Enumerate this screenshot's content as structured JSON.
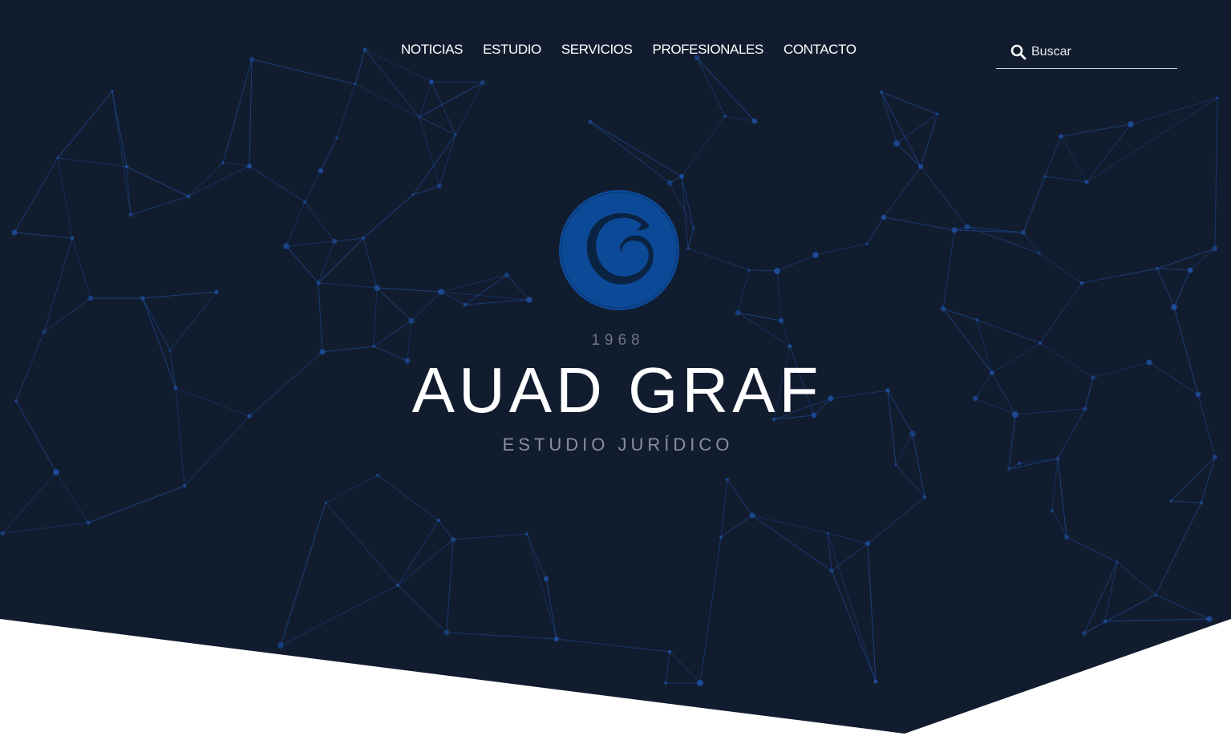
{
  "nav": {
    "items": [
      {
        "label": "NOTICIAS"
      },
      {
        "label": "ESTUDIO"
      },
      {
        "label": "SERVICIOS"
      },
      {
        "label": "PROFESIONALES"
      },
      {
        "label": "CONTACTO"
      }
    ]
  },
  "search": {
    "placeholder": "Buscar",
    "value": "",
    "icon": "search-icon"
  },
  "hero": {
    "logo_icon": "wave-logo-icon",
    "year": "1968",
    "brand": "AUAD GRAF",
    "tagline": "ESTUDIO JURÍDICO"
  },
  "colors": {
    "background": "#121c2f",
    "network": "#1e4f9e",
    "logo": "#0c4a98",
    "logo_dark": "#0a2342",
    "text": "#ffffff",
    "muted": "#8a909c"
  }
}
